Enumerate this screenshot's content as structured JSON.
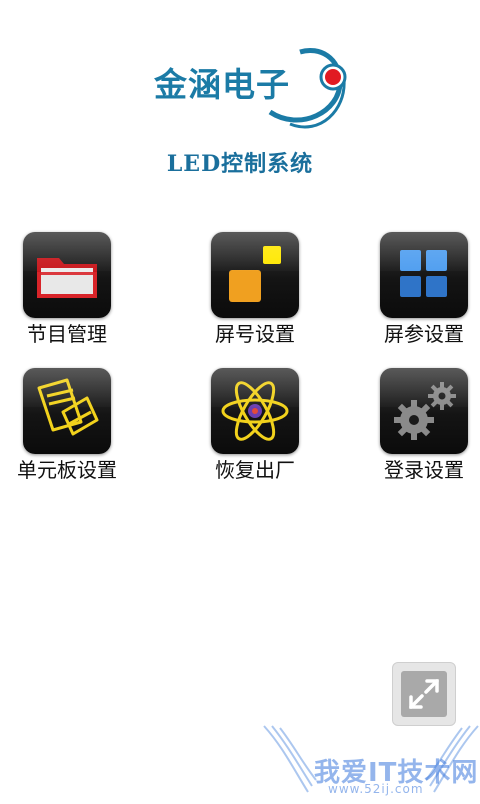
{
  "header": {
    "logo_text": "金涵电子",
    "title": "LED控制系统"
  },
  "menu": [
    {
      "label": "节目管理",
      "icon": "folder-icon"
    },
    {
      "label": "屏号设置",
      "icon": "screen-number-icon"
    },
    {
      "label": "屏参设置",
      "icon": "grid-icon"
    },
    {
      "label": "单元板设置",
      "icon": "documents-icon"
    },
    {
      "label": "恢复出厂",
      "icon": "atom-icon"
    },
    {
      "label": "登录设置",
      "icon": "gears-icon"
    }
  ],
  "expand_button": {
    "icon": "expand-arrows-icon"
  },
  "watermark": {
    "text": "我爱IT技术网",
    "subtext": "www.52ij.com"
  },
  "colors": {
    "brand": "#1b7ba6",
    "logo_red": "#e11b22",
    "folder_red": "#c8171c",
    "screen_orange": "#f0a020",
    "screen_yellow": "#ffe800",
    "grid_blue": "#3d8be0",
    "atom_yellow": "#f2d21c",
    "gears_gray": "#8a8a8a"
  }
}
